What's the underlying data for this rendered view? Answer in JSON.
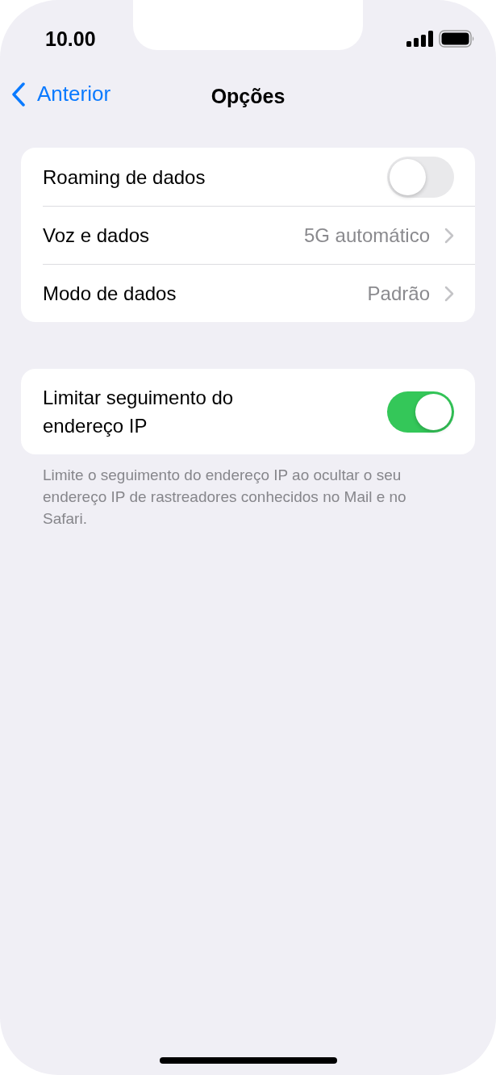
{
  "status_bar": {
    "time": "10.00"
  },
  "nav": {
    "back": "Anterior",
    "title": "Opções"
  },
  "groups": [
    {
      "rows": [
        {
          "kind": "toggle",
          "label": "Roaming de dados",
          "on": false
        },
        {
          "kind": "link",
          "label": "Voz e dados",
          "value": "5G automático"
        },
        {
          "kind": "link",
          "label": "Modo de dados",
          "value": "Padrão"
        }
      ]
    },
    {
      "rows": [
        {
          "kind": "toggle",
          "label": "Limitar seguimento do endereço IP",
          "on": true
        }
      ],
      "footer": "Limite o seguimento do endereço IP ao ocultar o seu endereço IP de rastreadores conhecidos no Mail e no Safari."
    }
  ]
}
